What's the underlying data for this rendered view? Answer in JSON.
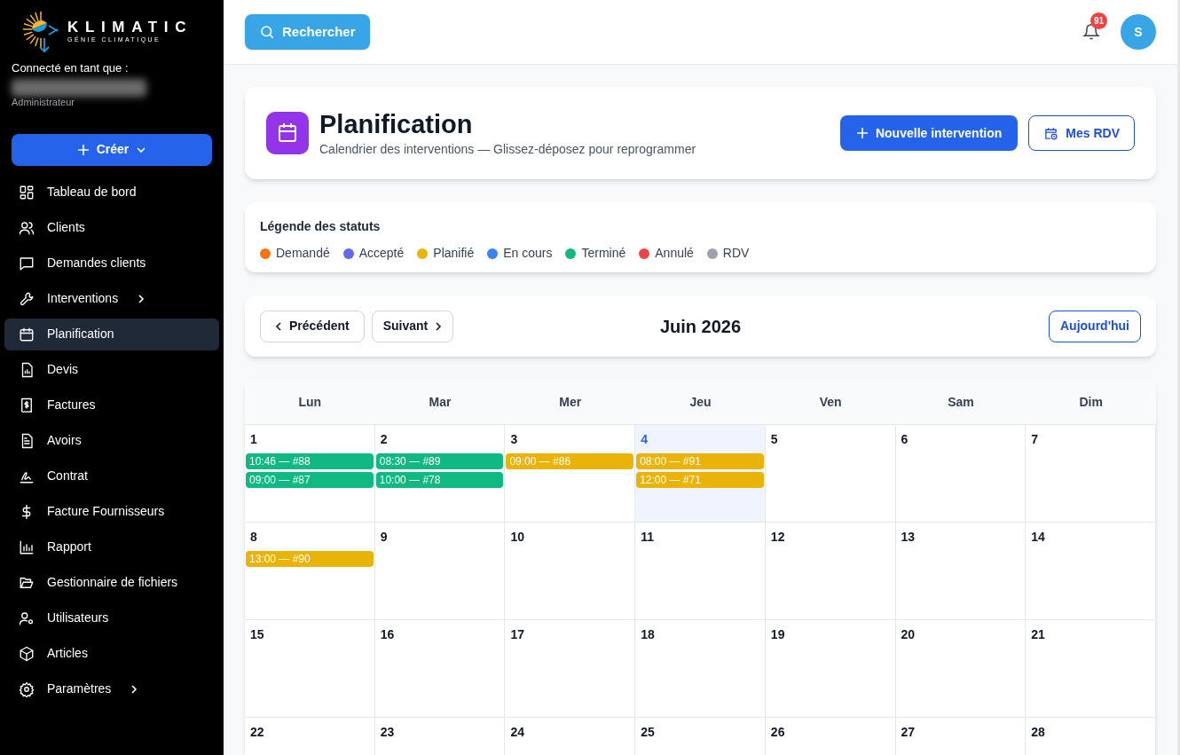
{
  "sidebar": {
    "logo": {
      "name": "KLIMATIC",
      "tagline": "GÉNIE CLIMATIQUE"
    },
    "user": {
      "caption": "Connecté en tant que :",
      "role": "Administrateur"
    },
    "create_button": {
      "label": "Créer"
    },
    "items": [
      {
        "label": "Tableau de bord",
        "selected": false,
        "submenu": false
      },
      {
        "label": "Clients",
        "selected": false,
        "submenu": false
      },
      {
        "label": "Demandes clients",
        "selected": false,
        "submenu": false
      },
      {
        "label": "Interventions",
        "selected": false,
        "submenu": true
      },
      {
        "label": "Planification",
        "selected": true,
        "submenu": false
      },
      {
        "label": "Devis",
        "selected": false,
        "submenu": false
      },
      {
        "label": "Factures",
        "selected": false,
        "submenu": false
      },
      {
        "label": "Avoirs",
        "selected": false,
        "submenu": false
      },
      {
        "label": "Contrat",
        "selected": false,
        "submenu": false
      },
      {
        "label": "Facture Fournisseurs",
        "selected": false,
        "submenu": false
      },
      {
        "label": "Rapport",
        "selected": false,
        "submenu": false
      },
      {
        "label": "Gestionnaire de fichiers",
        "selected": false,
        "submenu": false
      },
      {
        "label": "Utilisateurs",
        "selected": false,
        "submenu": false
      },
      {
        "label": "Articles",
        "selected": false,
        "submenu": false
      },
      {
        "label": "Paramètres",
        "selected": false,
        "submenu": true
      }
    ]
  },
  "topbar": {
    "search_button": "Rechercher",
    "notification_count": "91",
    "avatar": "S"
  },
  "page_header": {
    "title": "Planification",
    "subtitle": "Calendrier des interventions — Glissez-déposez pour reprogrammer",
    "buttons": [
      "Nouvelle intervention",
      "Mes RDV"
    ]
  },
  "legend": {
    "title": "Légende des statuts",
    "items": [
      {
        "label": "Demandé",
        "color": "#f97316"
      },
      {
        "label": "Accepté",
        "color": "#6366f1"
      },
      {
        "label": "Planifié",
        "color": "#eab308"
      },
      {
        "label": "En cours",
        "color": "#3b82f6"
      },
      {
        "label": "Terminé",
        "color": "#10b981"
      },
      {
        "label": "Annulé",
        "color": "#ef4444"
      },
      {
        "label": "RDV",
        "color": "#9ca3af"
      }
    ]
  },
  "calendar_nav": {
    "previous": "Précédent",
    "next": "Suivant",
    "month": "Juin 2026",
    "today": "Aujourd'hui"
  },
  "calendar": {
    "weekdays": [
      "Lun",
      "Mar",
      "Mer",
      "Jeu",
      "Ven",
      "Sam",
      "Dim"
    ],
    "weeks": [
      [
        {
          "day": "1",
          "today": false,
          "events": [
            {
              "label": "10:46 — #88",
              "color": "#10b981"
            },
            {
              "label": "09:00 — #87",
              "color": "#10b981"
            }
          ]
        },
        {
          "day": "2",
          "today": false,
          "events": [
            {
              "label": "08:30 — #89",
              "color": "#10b981"
            },
            {
              "label": "10:00 — #78",
              "color": "#10b981"
            }
          ]
        },
        {
          "day": "3",
          "today": false,
          "events": [
            {
              "label": "09:00 — #86",
              "color": "#eab308"
            }
          ]
        },
        {
          "day": "4",
          "today": true,
          "events": [
            {
              "label": "08:00 — #91",
              "color": "#eab308"
            },
            {
              "label": "12:00 — #71",
              "color": "#eab308"
            }
          ]
        },
        {
          "day": "5",
          "today": false
        },
        {
          "day": "6",
          "today": false
        },
        {
          "day": "7",
          "today": false
        }
      ],
      [
        {
          "day": "8",
          "today": false,
          "events": [
            {
              "label": "13:00 — #90",
              "color": "#eab308"
            }
          ]
        },
        {
          "day": "9",
          "today": false
        },
        {
          "day": "10",
          "today": false
        },
        {
          "day": "11",
          "today": false
        },
        {
          "day": "12",
          "today": false
        },
        {
          "day": "13",
          "today": false
        },
        {
          "day": "14",
          "today": false
        }
      ],
      [
        {
          "day": "15",
          "today": false
        },
        {
          "day": "16",
          "today": false
        },
        {
          "day": "17",
          "today": false
        },
        {
          "day": "18",
          "today": false
        },
        {
          "day": "19",
          "today": false
        },
        {
          "day": "20",
          "today": false
        },
        {
          "day": "21",
          "today": false
        }
      ],
      [
        {
          "day": "22",
          "today": false
        },
        {
          "day": "23",
          "today": false
        },
        {
          "day": "24",
          "today": false
        },
        {
          "day": "25",
          "today": false
        },
        {
          "day": "26",
          "today": false
        },
        {
          "day": "27",
          "today": false
        },
        {
          "day": "28",
          "today": false
        }
      ]
    ]
  }
}
